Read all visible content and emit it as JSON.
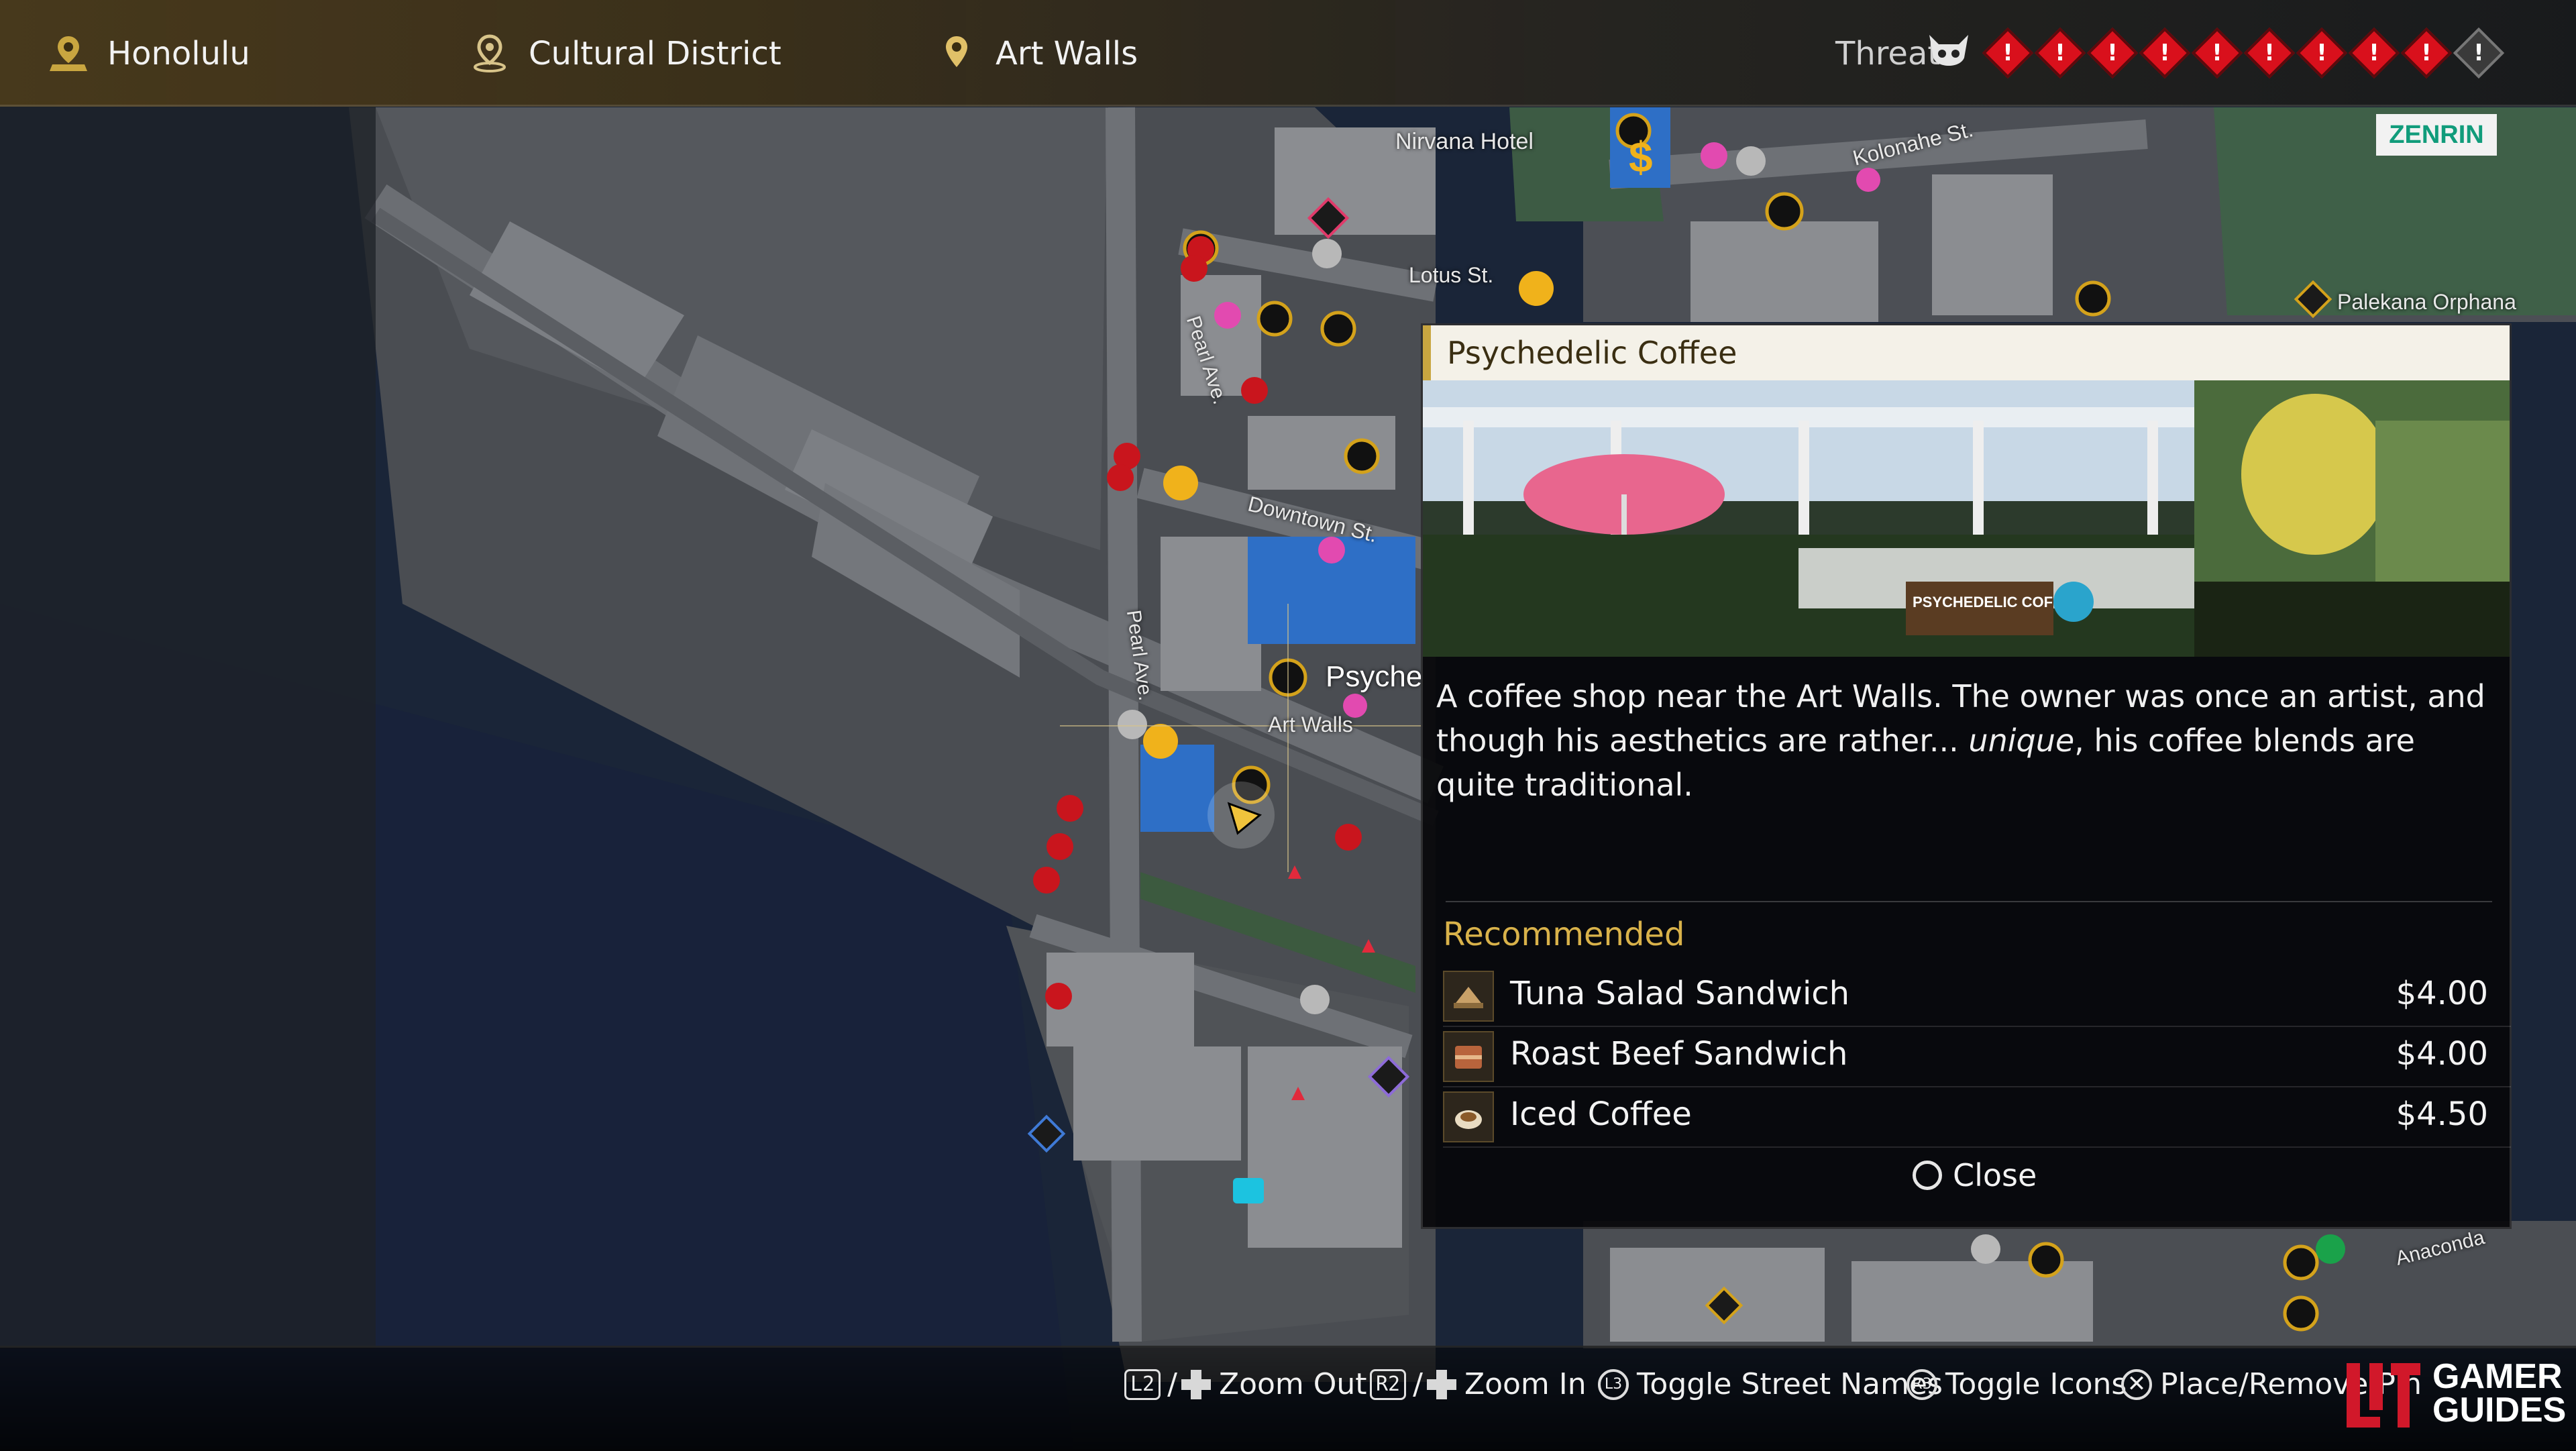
{
  "location_bar": {
    "city": {
      "label": "Honolulu",
      "icon": "map-pin-city-icon"
    },
    "district": {
      "label": "Cultural District",
      "icon": "map-pin-outline-icon"
    },
    "area": {
      "label": "Art Walls",
      "icon": "map-pin-icon"
    }
  },
  "threat": {
    "label": "Threat",
    "icon": "demon-mask-icon",
    "filled": 9,
    "total": 10,
    "color": "#d9101c"
  },
  "map_badge": {
    "label": "ZENRIN"
  },
  "map_labels": {
    "nirvana_hotel": "Nirvana Hotel",
    "kolonahe_st": "Kolonahe St.",
    "lotus_st": "Lotus St.",
    "pearl_ave_top": "Pearl Ave.",
    "pearl_ave_mid": "Pearl Ave.",
    "downtown_st": "Downtown St.",
    "art_walls": "Art Walls",
    "psyche": "Psyche",
    "palekana": "Palekana Orphana",
    "anaconda": "Anaconda"
  },
  "info_panel": {
    "title": "Psychedelic Coffee",
    "photo_sign": "PSYCHEDELIC COFFEE",
    "description_before": "A coffee shop near the Art Walls. The owner was once an artist, and though his aesthetics are rather... ",
    "description_em": "unique",
    "description_after": ", his coffee blends are quite traditional.",
    "recommended_label": "Recommended",
    "items": [
      {
        "name": "Tuna Salad Sandwich",
        "price": "$4.00",
        "icon": "sandwich-icon"
      },
      {
        "name": "Roast Beef Sandwich",
        "price": "$4.00",
        "icon": "sandwich-icon"
      },
      {
        "name": "Iced Coffee",
        "price": "$4.50",
        "icon": "coffee-cup-icon"
      }
    ],
    "close_label": "Close"
  },
  "controls": {
    "zoom_out": {
      "key": "L2",
      "sep": "/",
      "label": "Zoom Out"
    },
    "zoom_in": {
      "key": "R2",
      "sep": "/",
      "label": "Zoom In"
    },
    "street_names": {
      "key": "L3",
      "label": "Toggle Street Names"
    },
    "toggle_icons": {
      "key": "R3",
      "label": "Toggle Icons"
    },
    "place_remove": {
      "key": "✕",
      "label": "Place/Remove Pin"
    }
  },
  "watermark": {
    "line1": "GAMER",
    "line2": "GUIDES"
  }
}
